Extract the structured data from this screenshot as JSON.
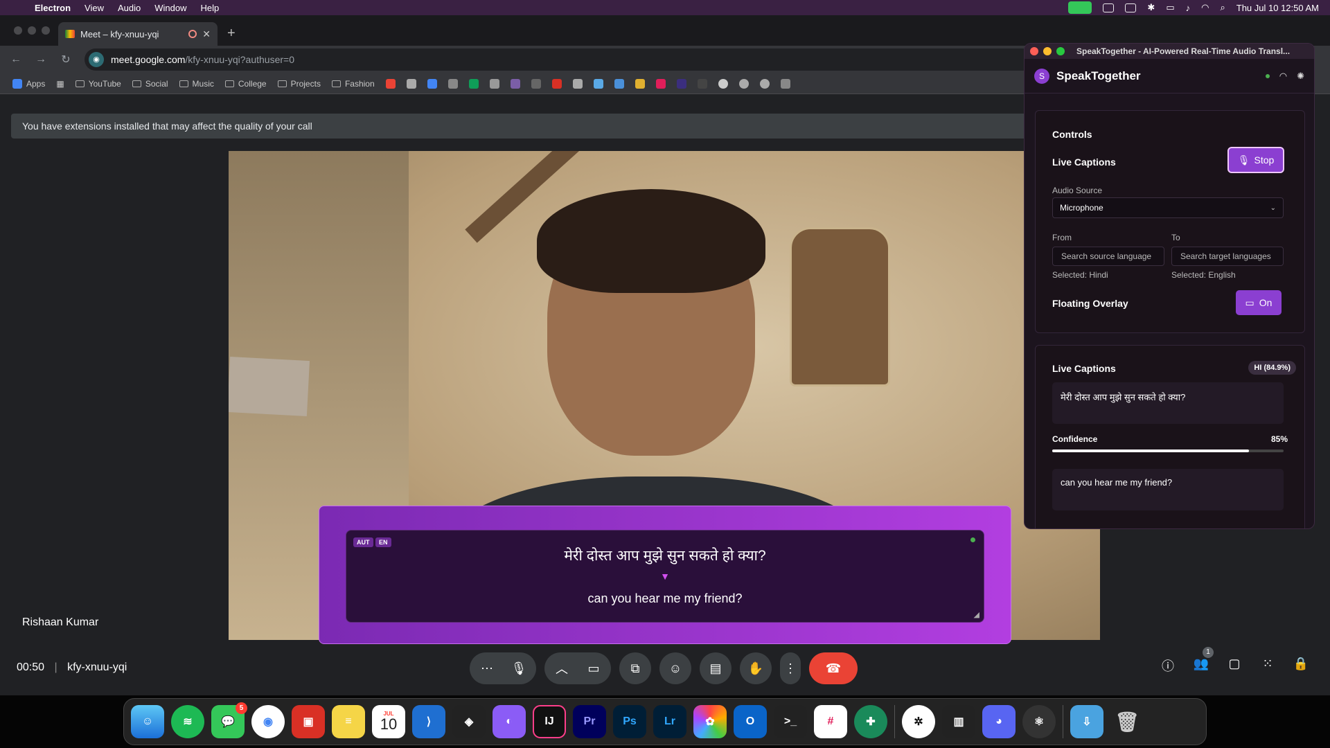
{
  "menubar": {
    "app_name": "Electron",
    "menus": [
      "View",
      "Audio",
      "Window",
      "Help"
    ],
    "clock": "Thu Jul 10  12:50 AM"
  },
  "browser": {
    "tab_title": "Meet – kfy-xnuu-yqi",
    "url_host": "meet.google.com",
    "url_path": "/kfy-xnuu-yqi?authuser=0",
    "bookmarks": {
      "apps": "Apps",
      "folders": [
        "YouTube",
        "Social",
        "Music",
        "College",
        "Projects",
        "Fashion"
      ]
    }
  },
  "meet": {
    "extension_banner": "You have extensions installed that may affect the quality of your call",
    "participant_name": "Rishaan Kumar",
    "call_time": "00:50",
    "meeting_code": "kfy-xnuu-yqi",
    "people_count": "1"
  },
  "overlay": {
    "source_tag": "AUT",
    "target_tag": "EN",
    "source_text": "मेरी दोस्त आप मुझे सुन सकते हो क्या?",
    "arrow": "▼",
    "target_text": "can you hear me my friend?"
  },
  "speaktogether": {
    "window_title": "SpeakTogether - AI-Powered Real-Time Audio Transl...",
    "logo_letter": "S",
    "app_name": "SpeakTogether",
    "controls": {
      "title": "Controls",
      "live_captions_label": "Live Captions",
      "stop_label": "Stop",
      "audio_source_label": "Audio Source",
      "audio_source_value": "Microphone",
      "from_label": "From",
      "to_label": "To",
      "source_placeholder": "Search source language",
      "target_placeholder": "Search target languages",
      "selected_source": "Selected: Hindi",
      "selected_target": "Selected: English",
      "floating_overlay_label": "Floating Overlay",
      "overlay_on_label": "On"
    },
    "captions": {
      "title": "Live Captions",
      "detected_badge": "HI (84.9%)",
      "source_text": "मेरी दोस्त आप मुझे सुन सकते हो क्या?",
      "confidence_label": "Confidence",
      "confidence_value": "85%",
      "confidence": 0.85,
      "target_text": "can you hear me my friend?"
    }
  },
  "dock": {
    "messages_badge": "5",
    "calendar_month": "JUL",
    "calendar_day": "10"
  }
}
